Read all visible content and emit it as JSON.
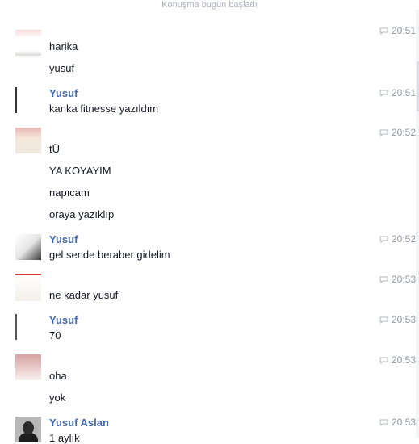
{
  "conversation_start": "Konuşma bugün başladı",
  "messages": [
    {
      "sender": "",
      "time": "20:51",
      "lines": [
        "harika",
        "yusuf"
      ]
    },
    {
      "sender": "Yusuf",
      "time": "20:51",
      "lines": [
        "kanka fitnesse yazıldım"
      ]
    },
    {
      "sender": "",
      "time": "20:52",
      "lines": [
        "tÜ",
        "YA KOYAYIM",
        "napıcam",
        "oraya yazıklıp"
      ]
    },
    {
      "sender": "Yusuf",
      "time": "20:52",
      "lines": [
        "gel sende beraber gidelim"
      ]
    },
    {
      "sender": "",
      "time": "20:53",
      "lines": [
        "ne kadar yusuf"
      ]
    },
    {
      "sender": "Yusuf",
      "time": "20:53",
      "lines": [
        "70"
      ]
    },
    {
      "sender": "",
      "time": "20:53",
      "lines": [
        "oha",
        "yok"
      ]
    },
    {
      "sender": "Yusuf Aslan",
      "time": "20:53",
      "lines": [
        "1 aylık"
      ]
    }
  ],
  "icons": {
    "timestamp_icon": "chat-bubble-icon"
  }
}
